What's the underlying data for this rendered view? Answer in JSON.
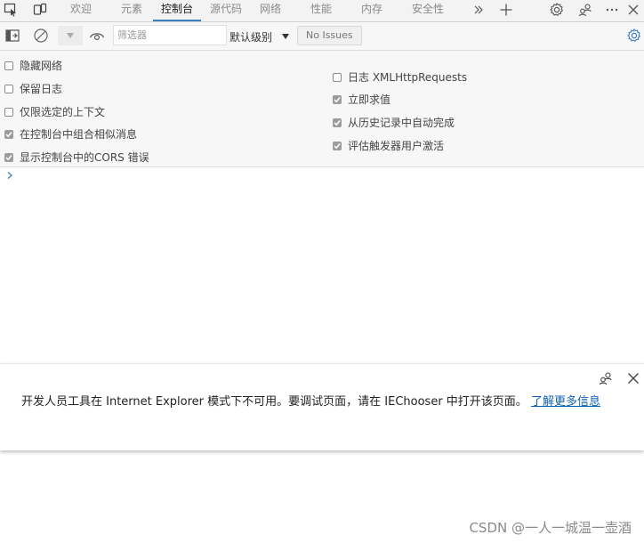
{
  "tabs": [
    {
      "label": "欢迎",
      "active": false
    },
    {
      "label": "元素",
      "active": false
    },
    {
      "label": "控制台",
      "active": true
    },
    {
      "label": "源代码",
      "active": false
    },
    {
      "label": "网络",
      "active": false
    },
    {
      "label": "性能",
      "active": false
    },
    {
      "label": "内存",
      "active": false
    },
    {
      "label": "安全性",
      "active": false
    }
  ],
  "toolbar": {
    "filter_placeholder": "筛选器",
    "level_label": "默认级别",
    "issues_label": "No Issues"
  },
  "settings": {
    "left": [
      {
        "label": "隐藏网络",
        "checked": false
      },
      {
        "label": "保留日志",
        "checked": false
      },
      {
        "label": "仅限选定的上下文",
        "checked": false
      },
      {
        "label": "在控制台中组合相似消息",
        "checked": true
      },
      {
        "label": "显示控制台中的CORS 错误",
        "checked": true
      }
    ],
    "right": [
      {
        "label": "日志 XMLHttpRequests",
        "checked": false
      },
      {
        "label": "立即求值",
        "checked": true
      },
      {
        "label": "从历史记录中自动完成",
        "checked": true
      },
      {
        "label": "评估触发器用户激活",
        "checked": true
      }
    ]
  },
  "notice": {
    "text": "开发人员工具在 Internet Explorer 模式下不可用。要调试页面，请在 IEChooser 中打开该页面。",
    "link_text": "了解更多信息"
  },
  "watermark": "CSDN @一人一城温一壶酒",
  "colors": {
    "accent": "#3c7fc4",
    "link": "#0f62b5",
    "checkbox_checked": "#9c9c9c"
  }
}
